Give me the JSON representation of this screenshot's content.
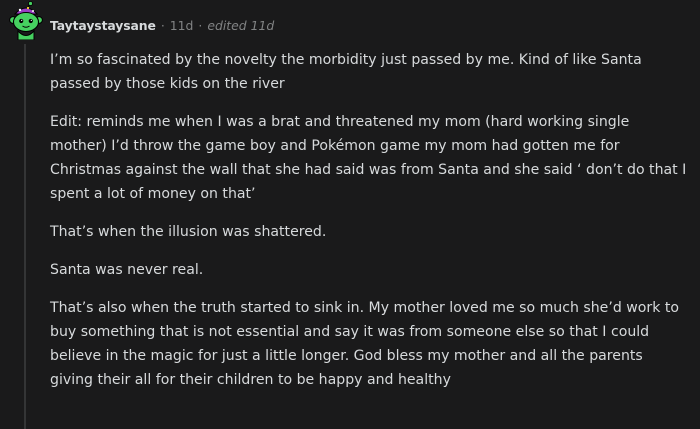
{
  "comment": {
    "username": "Taytaystaysane",
    "time_ago": "11d",
    "edited_label": "edited 11d",
    "paragraphs": [
      "I’m so fascinated by the novelty the morbidity just passed by me. Kind of like Santa passed by those kids on the river",
      "Edit: reminds me when I was a brat and threatened my mom (hard working single mother) I’d throw the game boy and Pokémon game my mom had gotten me for Christmas against the wall that she had said was from Santa and she said ‘ don’t do that I spent a lot of money on that’",
      "That’s when the illusion was shattered.",
      "Santa was never real.",
      "That’s also when the truth started to sink in. My mother loved me so much she’d work to buy something that is not essential and say it was from someone else so that I could believe in the magic for just a little longer. God bless my mother and all the parents giving their all for their children to be happy and healthy"
    ]
  },
  "colors": {
    "background": "#1a1a1b",
    "text": "#d7dadc",
    "meta": "#818384",
    "avatar_green": "#46d160",
    "avatar_hat": "#9b3fc4"
  },
  "icons": {
    "avatar": "snoo-avatar-icon"
  }
}
